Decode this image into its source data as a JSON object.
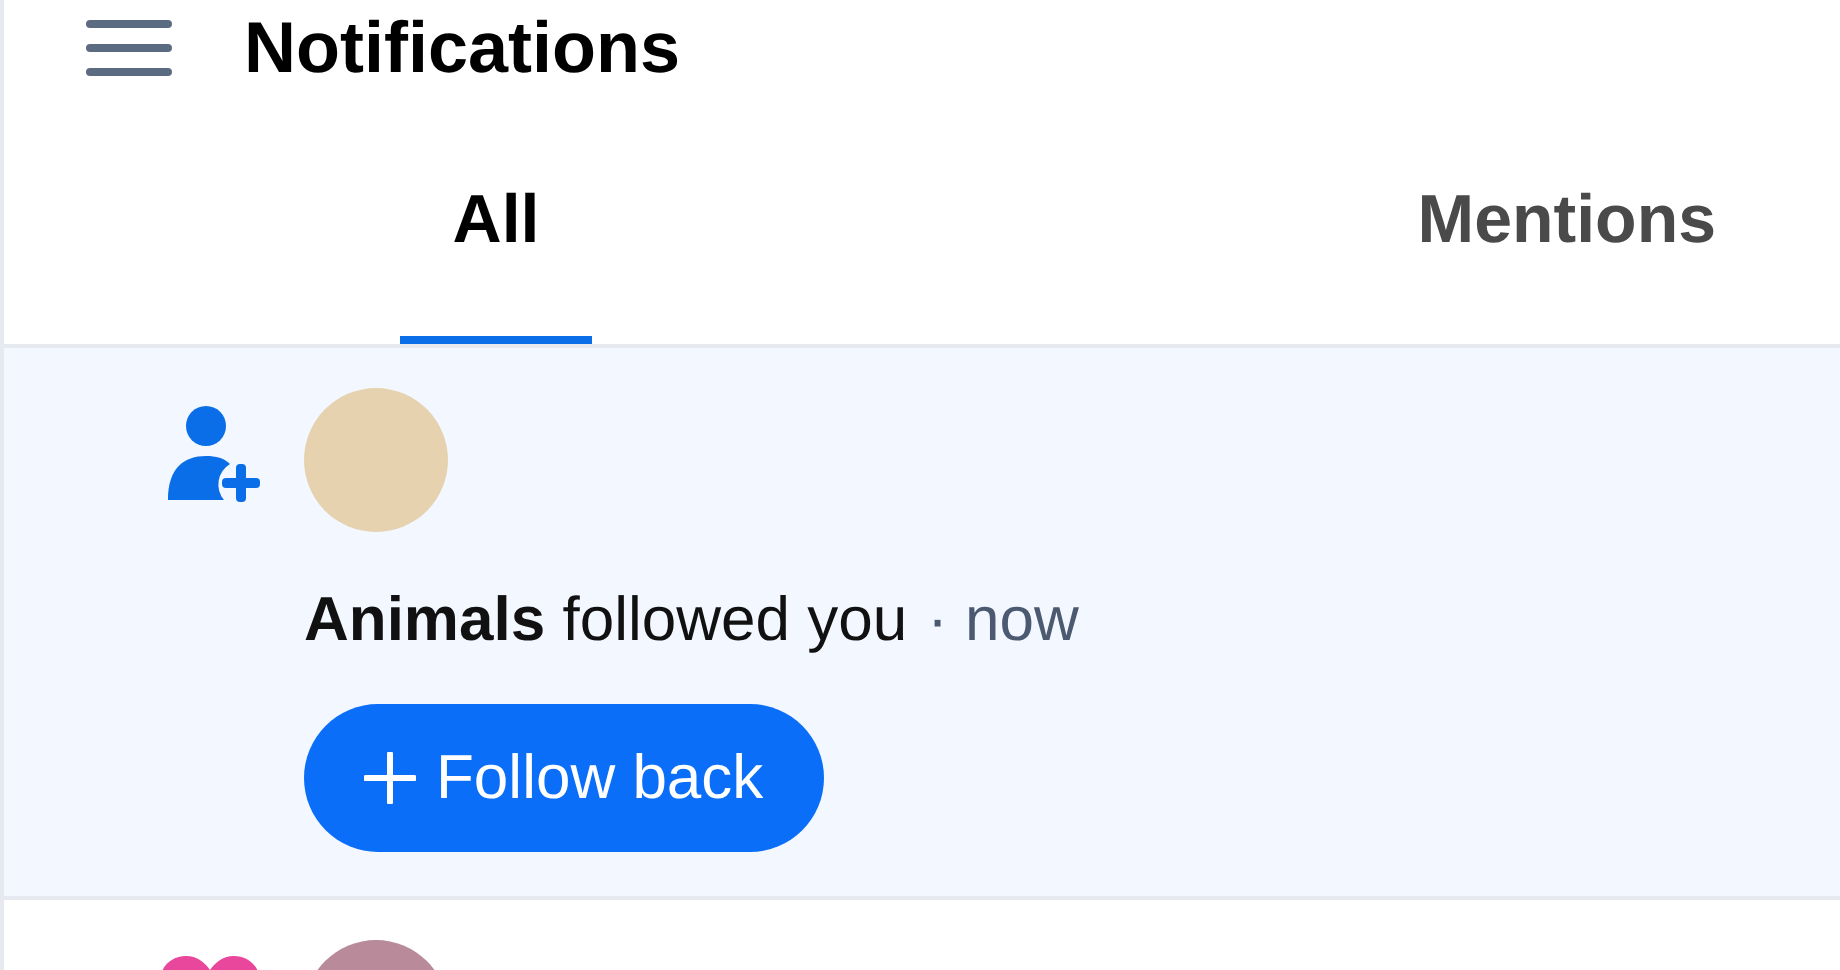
{
  "header": {
    "title": "Notifications"
  },
  "tabs": [
    {
      "label": "All",
      "selected": true
    },
    {
      "label": "Mentions",
      "selected": false
    }
  ],
  "notifications": [
    {
      "kind": "follow",
      "unread": true,
      "message": "**Animals** followed you",
      "time": "· now",
      "action": {
        "label": "Follow back"
      }
    },
    {
      "kind": "like",
      "unread": false
    }
  ]
}
